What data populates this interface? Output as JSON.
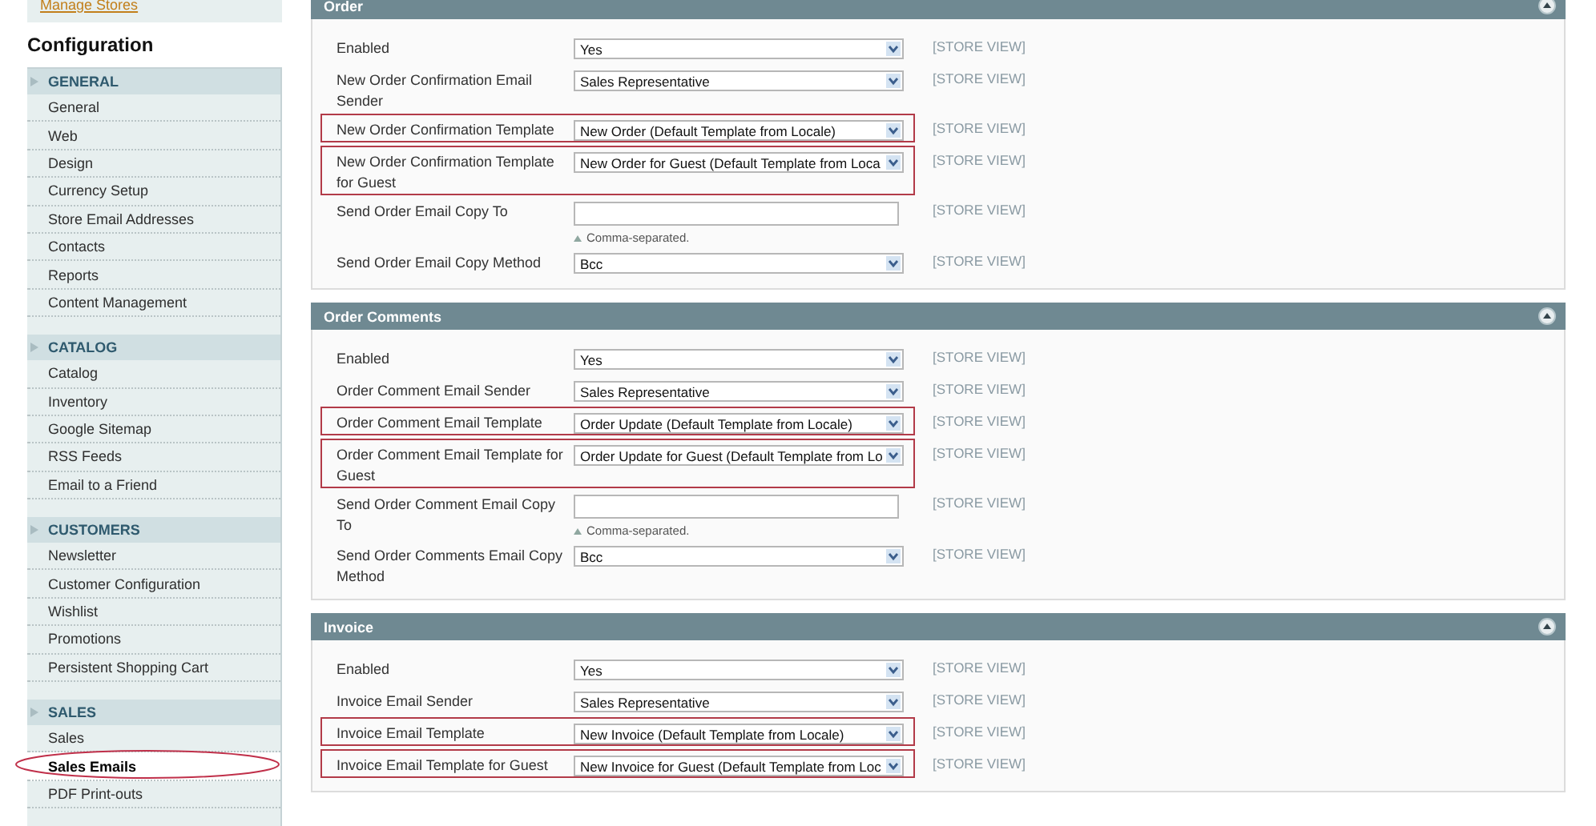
{
  "sidebar": {
    "top_link": "Manage Stores",
    "title": "Configuration",
    "groups": [
      {
        "label": "GENERAL",
        "items": [
          {
            "label": "General",
            "selected": false,
            "circled": false
          },
          {
            "label": "Web",
            "selected": false,
            "circled": false
          },
          {
            "label": "Design",
            "selected": false,
            "circled": false
          },
          {
            "label": "Currency Setup",
            "selected": false,
            "circled": false
          },
          {
            "label": "Store Email Addresses",
            "selected": false,
            "circled": false
          },
          {
            "label": "Contacts",
            "selected": false,
            "circled": false
          },
          {
            "label": "Reports",
            "selected": false,
            "circled": false
          },
          {
            "label": "Content Management",
            "selected": false,
            "circled": false
          }
        ]
      },
      {
        "label": "CATALOG",
        "items": [
          {
            "label": "Catalog",
            "selected": false,
            "circled": false
          },
          {
            "label": "Inventory",
            "selected": false,
            "circled": false
          },
          {
            "label": "Google Sitemap",
            "selected": false,
            "circled": false
          },
          {
            "label": "RSS Feeds",
            "selected": false,
            "circled": false
          },
          {
            "label": "Email to a Friend",
            "selected": false,
            "circled": false
          }
        ]
      },
      {
        "label": "CUSTOMERS",
        "items": [
          {
            "label": "Newsletter",
            "selected": false,
            "circled": false
          },
          {
            "label": "Customer Configuration",
            "selected": false,
            "circled": false
          },
          {
            "label": "Wishlist",
            "selected": false,
            "circled": false
          },
          {
            "label": "Promotions",
            "selected": false,
            "circled": false
          },
          {
            "label": "Persistent Shopping Cart",
            "selected": false,
            "circled": false
          }
        ]
      },
      {
        "label": "SALES",
        "items": [
          {
            "label": "Sales",
            "selected": false,
            "circled": false
          },
          {
            "label": "Sales Emails",
            "selected": true,
            "circled": true
          },
          {
            "label": "PDF Print-outs",
            "selected": false,
            "circled": false
          }
        ]
      }
    ]
  },
  "sections": [
    {
      "title": "Order",
      "expanded": true,
      "rows": [
        {
          "label": "Enabled",
          "kind": "select",
          "value": "Yes",
          "scope": "[STORE VIEW]",
          "highlighted": false
        },
        {
          "label": "New Order Confirmation Email Sender",
          "kind": "select",
          "value": "Sales Representative",
          "scope": "[STORE VIEW]",
          "highlighted": false
        },
        {
          "label": "New Order Confirmation Template",
          "kind": "select",
          "value": "New Order (Default Template from Locale)",
          "scope": "[STORE VIEW]",
          "highlighted": true
        },
        {
          "label": "New Order Confirmation Template for Guest",
          "kind": "select",
          "value": "New Order for Guest (Default Template from Loca",
          "scope": "[STORE VIEW]",
          "highlighted": true
        },
        {
          "label": "Send Order Email Copy To",
          "kind": "text",
          "note": "Comma-separated.",
          "scope": "[STORE VIEW]",
          "highlighted": false
        },
        {
          "label": "Send Order Email Copy Method",
          "kind": "select",
          "value": "Bcc",
          "scope": "[STORE VIEW]",
          "highlighted": false
        }
      ]
    },
    {
      "title": "Order Comments",
      "expanded": true,
      "rows": [
        {
          "label": "Enabled",
          "kind": "select",
          "value": "Yes",
          "scope": "[STORE VIEW]",
          "highlighted": false
        },
        {
          "label": "Order Comment Email Sender",
          "kind": "select",
          "value": "Sales Representative",
          "scope": "[STORE VIEW]",
          "highlighted": false
        },
        {
          "label": "Order Comment Email Template",
          "kind": "select",
          "value": "Order Update (Default Template from Locale)",
          "scope": "[STORE VIEW]",
          "highlighted": true
        },
        {
          "label": "Order Comment Email Template for Guest",
          "kind": "select",
          "value": "Order Update for Guest (Default Template from Lo",
          "scope": "[STORE VIEW]",
          "highlighted": true
        },
        {
          "label": "Send Order Comment Email Copy To",
          "kind": "text",
          "note": "Comma-separated.",
          "scope": "[STORE VIEW]",
          "highlighted": false
        },
        {
          "label": "Send Order Comments Email Copy Method",
          "kind": "select",
          "value": "Bcc",
          "scope": "[STORE VIEW]",
          "highlighted": false
        }
      ]
    },
    {
      "title": "Invoice",
      "expanded": true,
      "rows": [
        {
          "label": "Enabled",
          "kind": "select",
          "value": "Yes",
          "scope": "[STORE VIEW]",
          "highlighted": false
        },
        {
          "label": "Invoice Email Sender",
          "kind": "select",
          "value": "Sales Representative",
          "scope": "[STORE VIEW]",
          "highlighted": false
        },
        {
          "label": "Invoice Email Template",
          "kind": "select",
          "value": "New Invoice (Default Template from Locale)",
          "scope": "[STORE VIEW]",
          "highlighted": true
        },
        {
          "label": "Invoice Email Template for Guest",
          "kind": "select",
          "value": "New Invoice for Guest (Default Template from Loc",
          "scope": "[STORE VIEW]",
          "highlighted": true
        }
      ]
    }
  ]
}
